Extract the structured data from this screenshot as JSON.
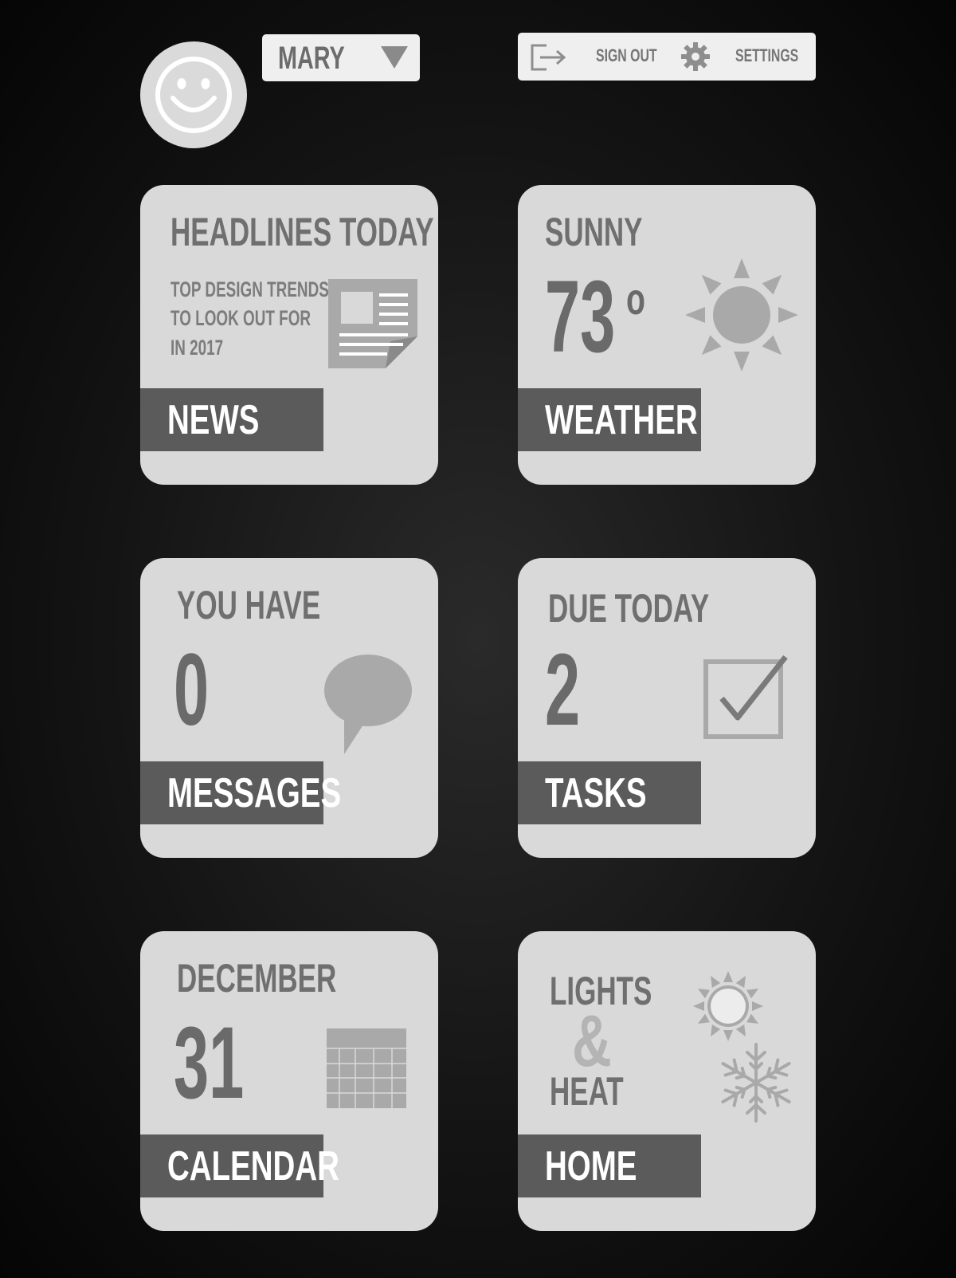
{
  "user": {
    "name": "MARY"
  },
  "toolbar": {
    "sign_out_label": "SIGN OUT",
    "settings_label": "SETTINGS"
  },
  "tiles": {
    "news": {
      "heading": "HEADLINES TODAY",
      "line1": "TOP DESIGN TRENDS",
      "line2": "TO LOOK OUT FOR",
      "line3": "IN 2017",
      "label": "NEWS"
    },
    "weather": {
      "condition": "SUNNY",
      "temperature": "73",
      "degree": "o",
      "label": "WEATHER"
    },
    "messages": {
      "heading": "YOU HAVE",
      "count": "0",
      "label": "MESSAGES"
    },
    "tasks": {
      "heading": "DUE TODAY",
      "count": "2",
      "label": "TASKS"
    },
    "calendar": {
      "month": "DECEMBER",
      "day": "31",
      "label": "CALENDAR"
    },
    "home": {
      "line1": "LIGHTS",
      "ampersand": "&",
      "line2": "HEAT",
      "label": "HOME"
    }
  },
  "colors": {
    "tile_bg": "#d9d9d9",
    "band_bg": "#5b5b5b",
    "icon_gray": "#a9a9a9",
    "text_gray": "#6f6f6f"
  }
}
